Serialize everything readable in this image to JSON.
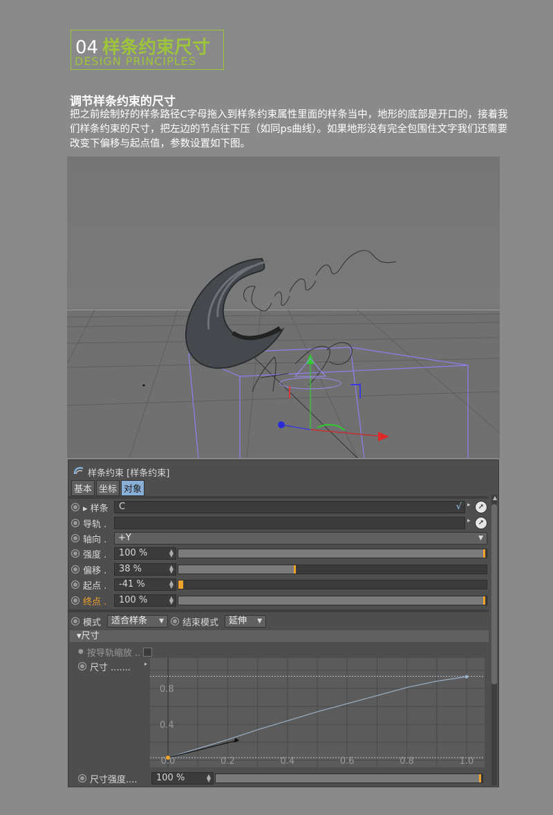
{
  "header": {
    "number": "04",
    "title": "样条约束尺寸",
    "subtitle": "DESIGN PRINCIPLES"
  },
  "section": {
    "title": "调节样条约束的尺寸",
    "description": "把之前绘制好的样条路径C字母拖入到样条约束属性里面的样条当中，地形的底部是开口的，接着我们样条约束的尺寸，把左边的节点往下压（如同ps曲线）。如果地形没有完全包围住文字我们还需要改变下偏移与起点值，参数设置如下图。"
  },
  "panel": {
    "title": "样条约束 [样条约束]",
    "tabs": [
      "基本",
      "坐标",
      "对象"
    ],
    "active_tab": "对象",
    "spline": {
      "label": "样条",
      "value": "C"
    },
    "rail": {
      "label": "导轨 .",
      "value": ""
    },
    "axis": {
      "label": "轴向 .",
      "value": "+Y"
    },
    "strength": {
      "label": "强度 .",
      "value": "100 %",
      "fraction": 1.0
    },
    "offset": {
      "label": "偏移 .",
      "value": "38 %",
      "fraction": 0.38
    },
    "start": {
      "label": "起点 .",
      "value": "-41 %",
      "fraction": 0.0
    },
    "end": {
      "label": "终点 .",
      "value": "100 %",
      "fraction": 1.0
    },
    "mode": {
      "label": "模式",
      "value": "适合样条"
    },
    "end_mode": {
      "label": "结束模式",
      "value": "延伸"
    },
    "size_group": "尺寸",
    "by_rail_scale": {
      "label": "按导轨缩放 ..",
      "checked": false
    },
    "size": {
      "label": "尺寸 ......."
    },
    "size_strength": {
      "label": "尺寸强度....",
      "value": "100 %",
      "fraction": 1.0
    }
  },
  "chart_data": {
    "type": "line",
    "title": "",
    "xlabel": "",
    "ylabel": "",
    "xlim": [
      0,
      1
    ],
    "ylim": [
      0,
      1
    ],
    "x_ticks": [
      "0.0",
      "0.2",
      "0.4",
      "0.6",
      "0.8",
      "1.0"
    ],
    "y_ticks": [
      "0.4",
      "0.8"
    ],
    "series": [
      {
        "x": [
          0.0,
          0.1,
          0.2,
          0.3,
          0.4,
          0.5,
          0.6,
          0.7,
          0.8,
          0.9,
          1.0
        ],
        "y": [
          0.03,
          0.13,
          0.23,
          0.34,
          0.44,
          0.54,
          0.63,
          0.72,
          0.81,
          0.88,
          0.93
        ]
      }
    ],
    "knots": [
      [
        0.0,
        0.03
      ],
      [
        1.0,
        0.93
      ]
    ],
    "tangent_handle": [
      0.23,
      0.22
    ],
    "grid": true,
    "color": "#9bb2c8"
  }
}
